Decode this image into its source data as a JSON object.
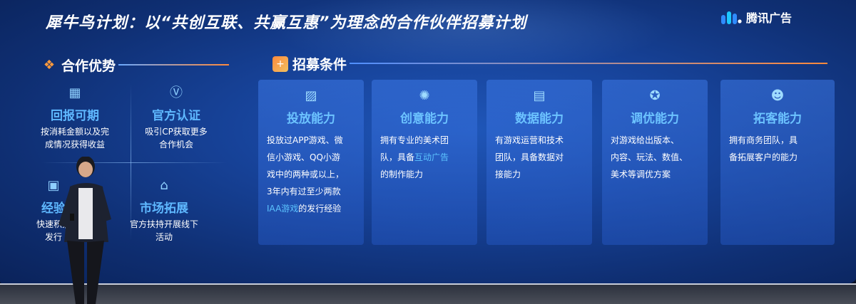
{
  "slide": {
    "title": "犀牛鸟计划：以“共创互联、共赢互惠”为理念的合作伙伴招募计划",
    "logo_text": "腾讯广告",
    "accent_colors": {
      "orange": "#ff8a3c",
      "light_blue": "#5fb8ff",
      "screen_blue": "#1f56b8"
    }
  },
  "advantages": {
    "heading": "合作优势",
    "items": [
      {
        "icon": "calendar-icon",
        "title": "回报可期",
        "desc": [
          "按消耗金额以及完",
          "成情况获得收益"
        ]
      },
      {
        "icon": "badge-v-icon",
        "title": "官方认证",
        "desc": [
          "吸引CP获取更多",
          "合作机会"
        ]
      },
      {
        "icon": "briefcase-icon",
        "title": "经验",
        "desc": [
          "快速积累",
          "发行"
        ]
      },
      {
        "icon": "store-icon",
        "title": "市场拓展",
        "desc": [
          "官方扶持开展线下",
          "活动"
        ]
      }
    ]
  },
  "requirements": {
    "heading": "招募条件",
    "cards": [
      {
        "icon": "image-icon",
        "title": "投放能力",
        "desc": [
          "投放过APP游戏、微",
          "信小游戏、QQ小游",
          "戏中的两种或以上，",
          "3年内有过至少两款"
        ],
        "highlight": "IAA游戏",
        "tail": "的发行经验"
      },
      {
        "icon": "lightbulb-icon",
        "title": "创意能力",
        "desc": [
          "拥有专业的美术团"
        ],
        "line2_pre": "队，具备",
        "highlight": "互动广告",
        "tail": "的制作能力"
      },
      {
        "icon": "chart-icon",
        "title": "数据能力",
        "desc": [
          "有游戏运营和技术",
          "团队，具备数据对",
          "接能力"
        ]
      },
      {
        "icon": "award-icon",
        "title": "调优能力",
        "desc": [
          "对游戏给出版本、",
          "内容、玩法、数值、",
          "美术等调优方案"
        ]
      },
      {
        "icon": "team-icon",
        "title": "拓客能力",
        "desc": [
          "拥有商务团队，具",
          "备拓展客户的能力"
        ]
      }
    ]
  }
}
